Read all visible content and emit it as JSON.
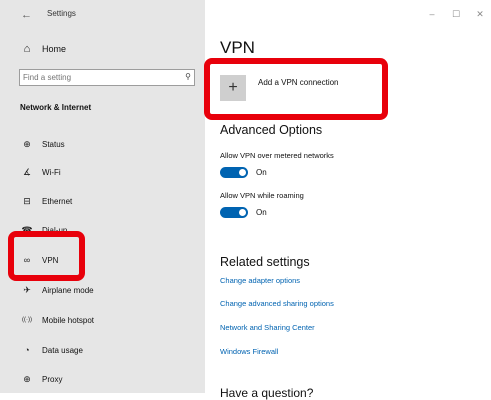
{
  "window": {
    "title": "Settings",
    "controls": {
      "minimize": "–",
      "maximize": "☐",
      "close": "✕"
    }
  },
  "sidebar": {
    "home_label": "Home",
    "search_placeholder": "Find a setting",
    "section_title": "Network & Internet",
    "items": [
      {
        "label": "Status",
        "icon": "status-icon",
        "glyph": "⊕"
      },
      {
        "label": "Wi-Fi",
        "icon": "wifi-icon",
        "glyph": "∡"
      },
      {
        "label": "Ethernet",
        "icon": "ethernet-icon",
        "glyph": "⊟"
      },
      {
        "label": "Dial-up",
        "icon": "dialup-icon",
        "glyph": "☎"
      },
      {
        "label": "VPN",
        "icon": "vpn-icon",
        "glyph": "∞",
        "selected": true
      },
      {
        "label": "Airplane mode",
        "icon": "airplane-icon",
        "glyph": "✈"
      },
      {
        "label": "Mobile hotspot",
        "icon": "hotspot-icon",
        "glyph": "((·))"
      },
      {
        "label": "Data usage",
        "icon": "data-usage-icon",
        "glyph": "◔"
      },
      {
        "label": "Proxy",
        "icon": "proxy-icon",
        "glyph": "⊕"
      }
    ]
  },
  "main": {
    "title": "VPN",
    "add_vpn_label": "Add a VPN connection",
    "advanced_title": "Advanced Options",
    "options": [
      {
        "label": "Allow VPN over metered networks",
        "state": "On",
        "on": true
      },
      {
        "label": "Allow VPN while roaming",
        "state": "On",
        "on": true
      }
    ],
    "related_title": "Related settings",
    "related_links": [
      "Change adapter options",
      "Change advanced sharing options",
      "Network and Sharing Center",
      "Windows Firewall"
    ],
    "question_title": "Have a question?"
  },
  "colors": {
    "accent": "#0063b1",
    "sidebar_bg": "#e6e6e6",
    "highlight": "#e8000b"
  }
}
